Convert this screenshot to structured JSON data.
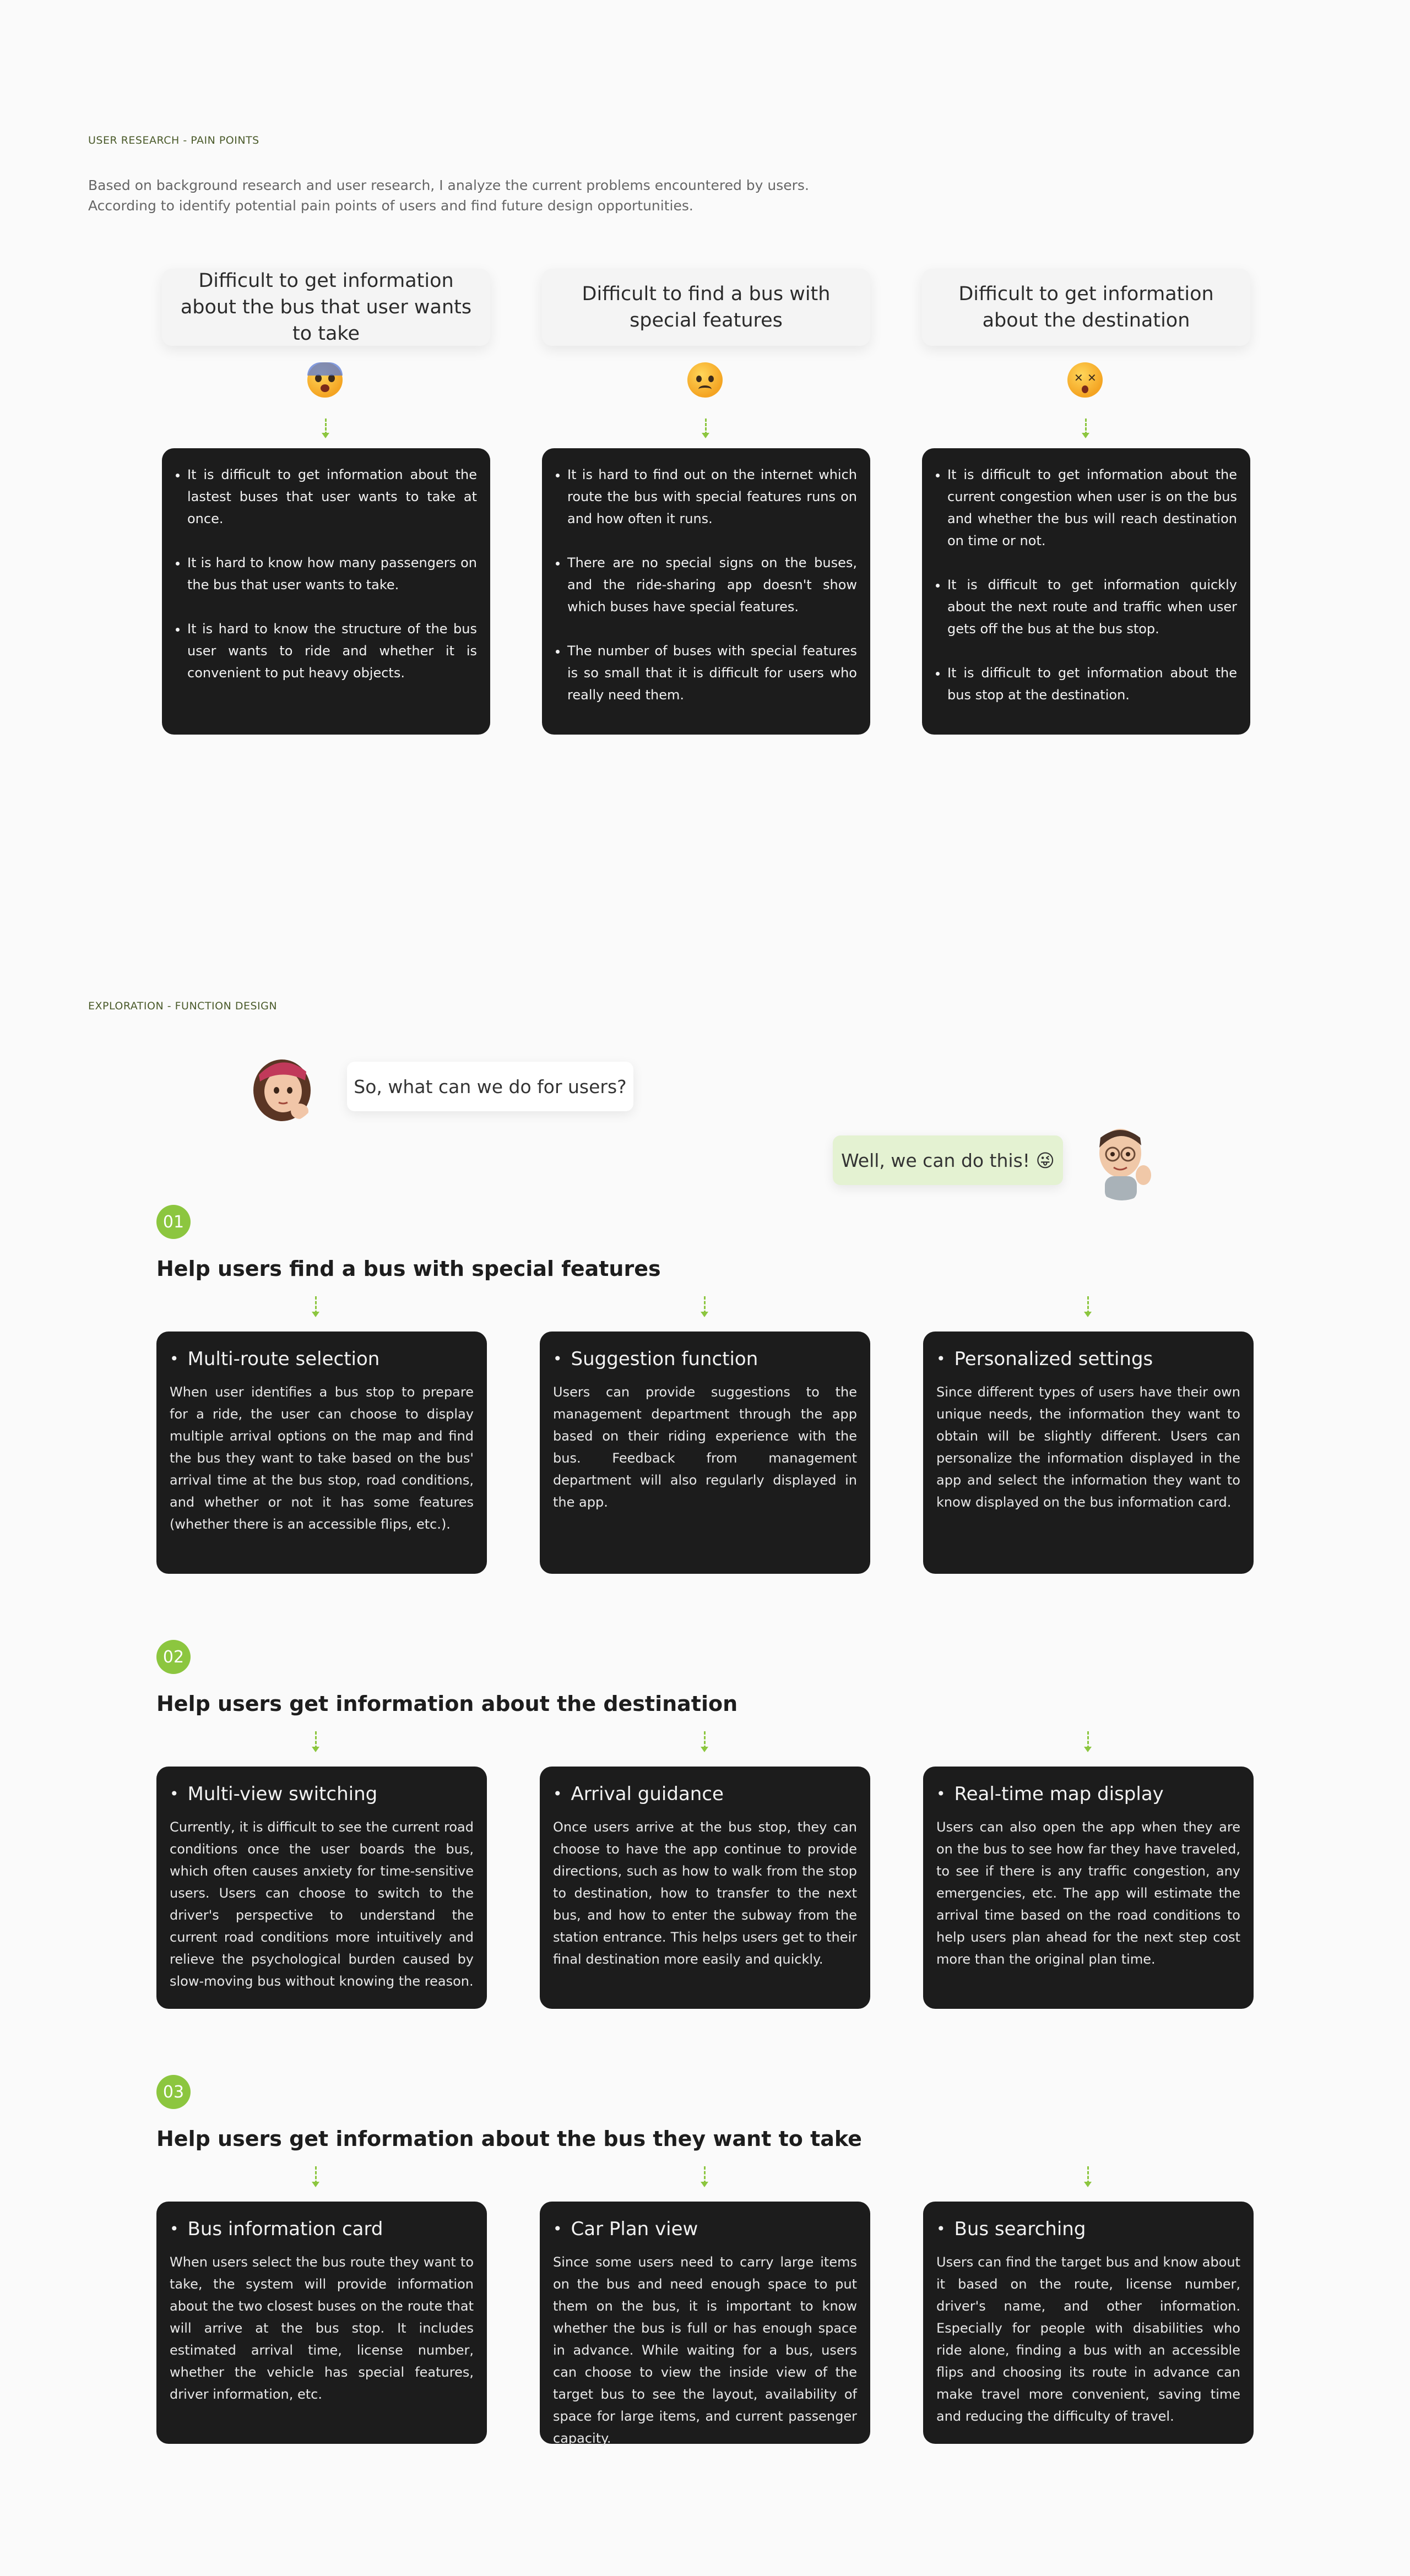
{
  "research": {
    "label": "USER RESEARCH  -  PAIN POINTS",
    "intro_line1": "Based on background research and user research, I analyze the current problems encountered by users.",
    "intro_line2": "According to identify potential pain points of users and find future design opportunities.",
    "pain_points": [
      {
        "title": "Difficult to get information about the bus that user wants to take",
        "emoji": "fearful-face-icon",
        "items": [
          "It is difficult to get information about the lastest buses that user wants to take at once.",
          "It is hard to know how many passengers on the bus that user wants to take.",
          "It is hard to know the structure of the bus user wants to ride and whether it is convenient to put heavy objects."
        ]
      },
      {
        "title": "Difficult to find a bus with special features",
        "emoji": "frowning-face-icon",
        "items": [
          "It is hard to find out on the internet which route the bus with special features runs on and how often it runs.",
          "There are no special signs on the buses, and the ride-sharing app doesn't show which buses have special features.",
          "The number of buses with special features is so small that it is difficult for users who really need them."
        ]
      },
      {
        "title": "Difficult to get information about the destination",
        "emoji": "dizzy-face-icon",
        "items": [
          "It is difficult to get information about the current congestion when user is on the bus and whether the bus will reach destination on time or not.",
          "It is difficult to get information quickly about the next route and traffic when user gets off the bus at the bus stop.",
          "It is difficult to get information about the bus stop at the destination."
        ]
      }
    ]
  },
  "exploration": {
    "label": "EXPLORATION  -  FUNCTION DESIGN",
    "question": "So, what can we do for users?",
    "answer": "Well, we can do this! 😜",
    "groups": [
      {
        "number": "01",
        "title": "Help users find a bus with special features",
        "cards": [
          {
            "title": "Multi-route selection",
            "body": "When user identifies a bus stop to prepare for a ride, the user can choose to display multiple arrival options on the map and find the bus they want to take based on the bus' arrival time at the bus stop, road conditions, and whether or not it has some features (whether there is an accessible flips, etc.)."
          },
          {
            "title": "Suggestion function",
            "body": "Users can provide suggestions to the management department through the app based on their riding experience with the bus. Feedback from management department will also regularly displayed in the app."
          },
          {
            "title": "Personalized settings",
            "body": "Since different types of users have their own unique needs, the information they want to obtain will be slightly different. Users can personalize the information displayed in the app and select the information they want to know displayed on the bus information card."
          }
        ]
      },
      {
        "number": "02",
        "title": "Help users get information about the destination",
        "cards": [
          {
            "title": "Multi-view switching",
            "body": "Currently, it is difficult to see the current road conditions once the user boards the bus, which often causes anxiety for time-sensitive users. Users can choose to switch to the driver's perspective to understand the current road conditions more intuitively and relieve the psychological burden caused by slow-moving bus without knowing the reason."
          },
          {
            "title": "Arrival guidance",
            "body": "Once users arrive at the bus stop, they can choose to have the app continue to provide directions, such as how to walk from the stop to destination, how to transfer to the next bus, and how to enter the subway from the station entrance. This helps users get to their final destination more easily and quickly."
          },
          {
            "title": "Real-time map display",
            "body": "Users can also open the app when they are on the bus to see how far they have traveled, to see if there is any traffic congestion, any emergencies, etc. The app will estimate the arrival time based on the road conditions to help users plan ahead for the next step cost more than the original plan time."
          }
        ]
      },
      {
        "number": "03",
        "title": "Help users get information about the bus they want to take",
        "cards": [
          {
            "title": "Bus information card",
            "body": "When users select the bus route they want to take, the system will provide information about the two closest buses on the route that will arrive at the bus stop. It includes estimated arrival time, license number, whether the vehicle has special features, driver information, etc."
          },
          {
            "title": "Car Plan view",
            "body": "Since some users need to carry large items on the bus and need enough space to put them on the bus, it is important to know whether the bus is full or has enough space in advance. While waiting for a bus, users can choose to view the inside view of the target bus to see the layout, availability of space for large items, and current passenger capacity."
          },
          {
            "title": "Bus searching",
            "body": "Users can find the target bus and know about it based on the route, license number, driver's name, and other information. Especially for people with disabilities who ride alone, finding a bus with an accessible flips and choosing its route in advance can make travel more convenient, saving time and reducing the difficulty of travel."
          }
        ]
      }
    ]
  },
  "colors": {
    "accent": "#8cc63f",
    "card": "#1c1c1c",
    "background": "#fafafa"
  }
}
